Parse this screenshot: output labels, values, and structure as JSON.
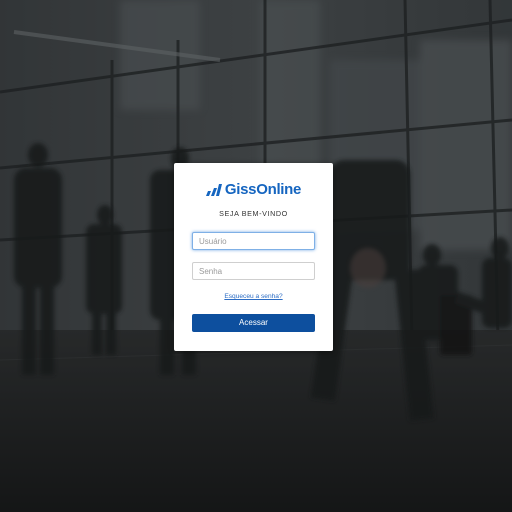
{
  "brand": {
    "name": "GissOnline",
    "color": "#1565c0"
  },
  "login": {
    "welcome": "SEJA BEM-VINDO",
    "username_placeholder": "Usuário",
    "password_placeholder": "Senha",
    "forgot_link": "Esqueceu a senha?",
    "submit_label": "Acessar",
    "button_color": "#0d4f9e"
  },
  "background": {
    "description_icon": "airport-terminal-photo",
    "overlay_color": "#000000"
  }
}
